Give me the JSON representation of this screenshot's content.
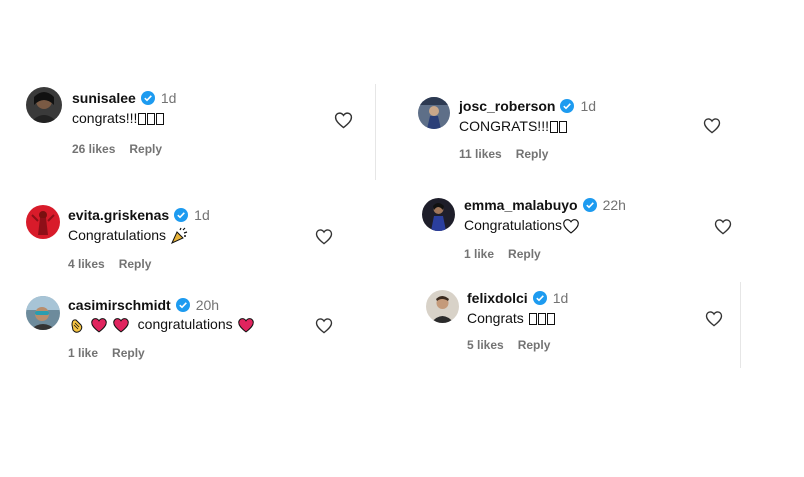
{
  "comments": [
    {
      "username": "sunisalee",
      "time": "1d",
      "text": "congrats!!!",
      "likes": "26 likes",
      "reply": "Reply",
      "verified": true
    },
    {
      "username": "josc_roberson",
      "time": "1d",
      "text": "CONGRATS!!!",
      "likes": "11 likes",
      "reply": "Reply",
      "verified": true
    },
    {
      "username": "evita.griskenas",
      "time": "1d",
      "text": "Congratulations",
      "likes": "4 likes",
      "reply": "Reply",
      "verified": true
    },
    {
      "username": "emma_malabuyo",
      "time": "22h",
      "text": "Congratulations",
      "likes": "1 like",
      "reply": "Reply",
      "verified": true
    },
    {
      "username": "casimirschmidt",
      "time": "20h",
      "text": "congratulations",
      "likes": "1 like",
      "reply": "Reply",
      "verified": true
    },
    {
      "username": "felixdolci",
      "time": "1d",
      "text": "Congrats",
      "likes": "5 likes",
      "reply": "Reply",
      "verified": true
    }
  ],
  "colors": {
    "verified": "#1d9bf0",
    "secondary_text": "#737373",
    "heart_emoji": "#e0245e",
    "text": "#111111"
  }
}
